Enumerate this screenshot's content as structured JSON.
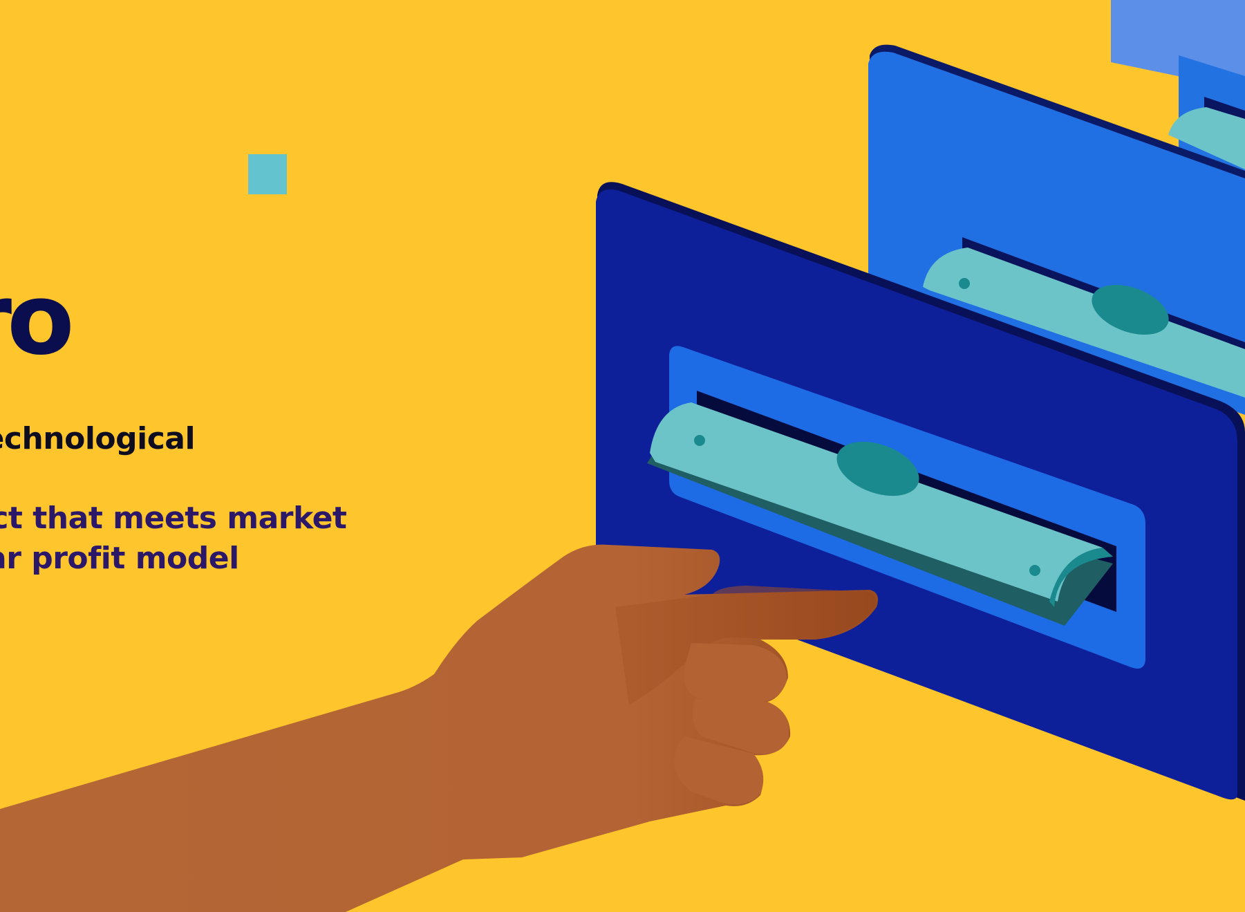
{
  "hero": {
    "headline": "Pro",
    "line_1": "technological",
    "line_2": "ect that meets market",
    "line_3": "ar profit model"
  },
  "colors": {
    "background": "#FEC52C",
    "headline": "#0A0E4E",
    "body_text": "#0D0D1F",
    "accent_text": "#2B1869",
    "panel_front": "#0D1E99",
    "panel_back": "#2170E3",
    "slot_frame": "#1E6BE6",
    "banknote": "#6CC4C9",
    "banknote_mark": "#1A8A8E",
    "hand_skin": "#B36333",
    "square": "#63C3CF"
  },
  "icons": {
    "illustration": "hand-inserting-banknote-illustration",
    "square": "teal-square-icon"
  }
}
